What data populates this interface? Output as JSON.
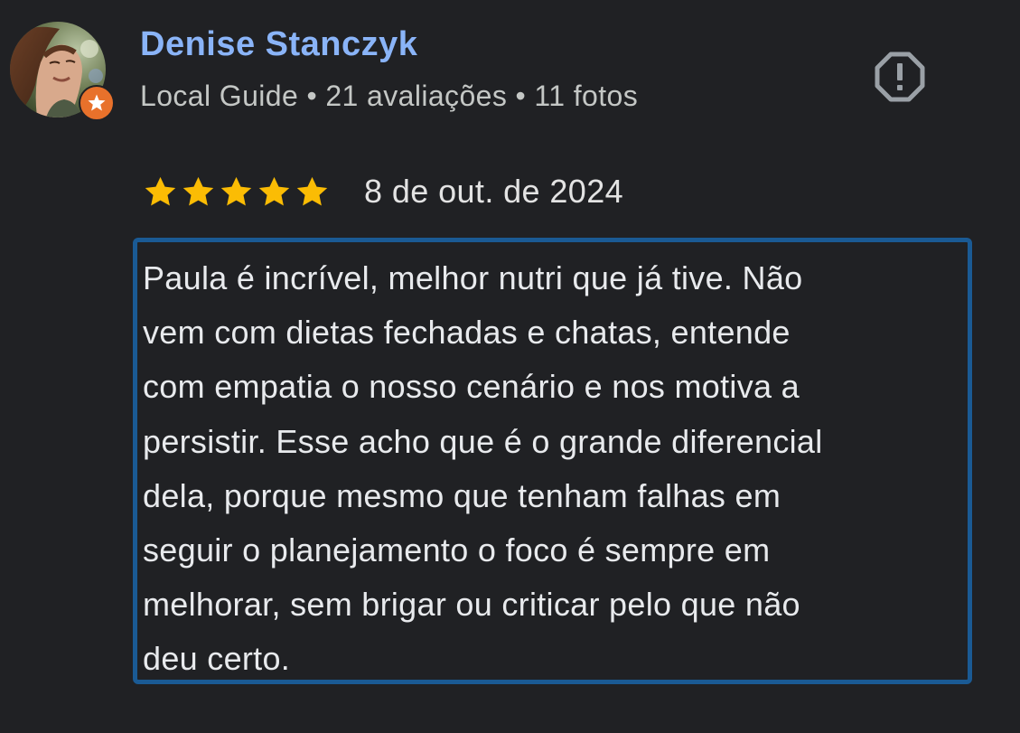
{
  "reviewer": {
    "name": "Denise Stanczyk",
    "meta": "Local Guide • 21 avaliações • 11 fotos",
    "avatar_icon": "user-photo",
    "badge_icon": "local-guide-star-icon",
    "badge_color": "#e8712b"
  },
  "actions": {
    "report_icon": "report-octagon-icon"
  },
  "rating": {
    "stars": 5,
    "max_stars": 5,
    "star_color": "#fbbc04",
    "date": "8 de out. de 2024"
  },
  "review": {
    "lines": [
      "Paula é incrível, melhor nutri que já tive. Não",
      "vem com dietas fechadas e chatas, entende",
      "com empatia o nosso cenário e nos motiva a",
      "persistir. Esse acho que é o grande diferencial",
      "dela, porque mesmo que tenham falhas em",
      "seguir o planejamento o foco é sempre em",
      "melhorar, sem brigar ou criticar pelo que não",
      "deu certo."
    ],
    "highlight_color": "#1a5a94"
  },
  "theme": {
    "background": "#202124",
    "name_color": "#8ab4f8",
    "meta_color": "#c4c7c5",
    "text_color": "#e8eaed"
  }
}
